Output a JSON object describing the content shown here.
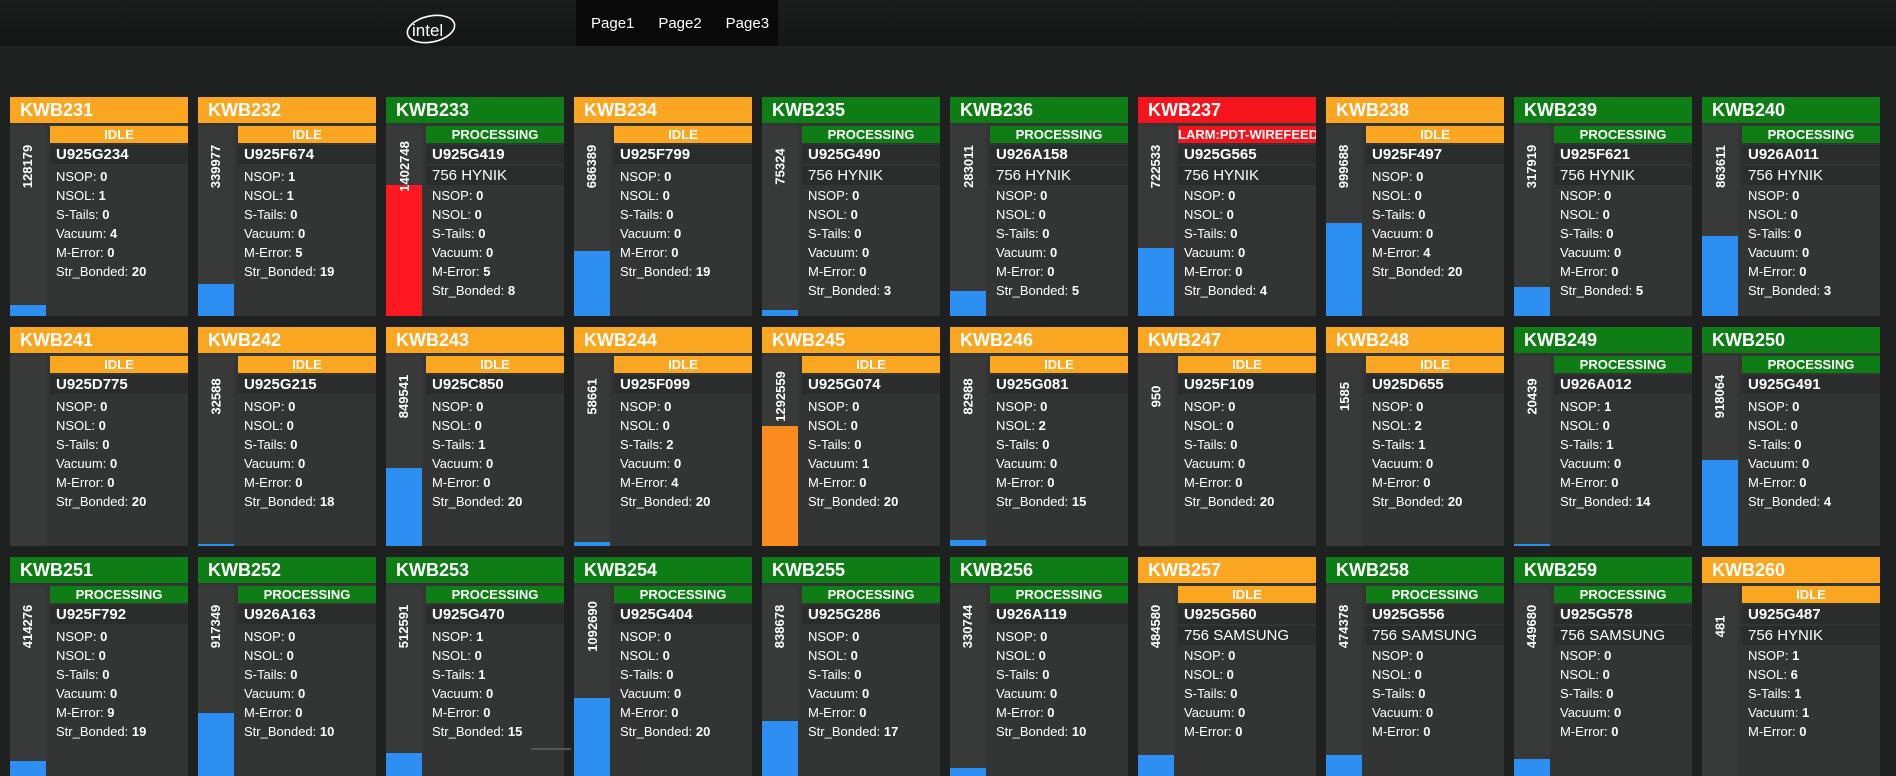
{
  "nav": [
    "Page1",
    "Page2",
    "Page3"
  ],
  "colors": {
    "idle": "#fba620",
    "processing": "#0e7d16",
    "alarm": "#f5141c",
    "bar_blue": "#2d8ff2",
    "bar_red": "#ff1721",
    "bar_orange": "#fb8b1e"
  },
  "icons": {
    "logo": "intel-logo"
  },
  "stat_labels": [
    "NSOP:",
    "NSOL:",
    "S-Tails:",
    "Vacuum:",
    "M-Error:",
    "Str_Bonded:"
  ],
  "machines": [
    {
      "name": "KWB231",
      "status": "IDLE",
      "state": "idle",
      "count": "128179",
      "level": 0.06,
      "bar": "blue",
      "unit": "U925G234",
      "sub": "",
      "stats": [
        "0",
        "1",
        "0",
        "4",
        "0",
        "20"
      ]
    },
    {
      "name": "KWB232",
      "status": "IDLE",
      "state": "idle",
      "count": "339977",
      "level": 0.17,
      "bar": "blue",
      "unit": "U925F674",
      "sub": "",
      "stats": [
        "1",
        "1",
        "0",
        "0",
        "5",
        "19"
      ]
    },
    {
      "name": "KWB233",
      "status": "PROCESSING",
      "state": "processing",
      "count": "1402748",
      "level": 0.69,
      "bar": "red",
      "unit": "U925G419",
      "sub": "756 HYNIK",
      "stats": [
        "0",
        "0",
        "0",
        "0",
        "5",
        "8"
      ]
    },
    {
      "name": "KWB234",
      "status": "IDLE",
      "state": "idle",
      "count": "686389",
      "level": 0.34,
      "bar": "blue",
      "unit": "U925F799",
      "sub": "",
      "stats": [
        "0",
        "0",
        "0",
        "0",
        "0",
        "19"
      ]
    },
    {
      "name": "KWB235",
      "status": "PROCESSING",
      "state": "processing",
      "count": "75324",
      "level": 0.03,
      "bar": "blue",
      "unit": "U925G490",
      "sub": "756 HYNIK",
      "stats": [
        "0",
        "0",
        "0",
        "0",
        "0",
        "3"
      ]
    },
    {
      "name": "KWB236",
      "status": "PROCESSING",
      "state": "processing",
      "count": "283011",
      "level": 0.13,
      "bar": "blue",
      "unit": "U926A158",
      "sub": "756 HYNIK",
      "stats": [
        "0",
        "0",
        "0",
        "0",
        "0",
        "5"
      ]
    },
    {
      "name": "KWB237",
      "status": "LARM:PDT-WIREFEED",
      "state": "alarm",
      "count": "722533",
      "level": 0.36,
      "bar": "blue",
      "unit": "U925G565",
      "sub": "756 HYNIK",
      "stats": [
        "0",
        "0",
        "0",
        "0",
        "0",
        "4"
      ]
    },
    {
      "name": "KWB238",
      "status": "IDLE",
      "state": "idle",
      "count": "999688",
      "level": 0.49,
      "bar": "blue",
      "unit": "U925F497",
      "sub": "",
      "stats": [
        "0",
        "0",
        "0",
        "0",
        "4",
        "20"
      ]
    },
    {
      "name": "KWB239",
      "status": "PROCESSING",
      "state": "processing",
      "count": "317919",
      "level": 0.15,
      "bar": "blue",
      "unit": "U925F621",
      "sub": "756 HYNIK",
      "stats": [
        "0",
        "0",
        "0",
        "0",
        "0",
        "5"
      ]
    },
    {
      "name": "KWB240",
      "status": "PROCESSING",
      "state": "processing",
      "count": "863611",
      "level": 0.42,
      "bar": "blue",
      "unit": "U926A011",
      "sub": "756 HYNIK",
      "stats": [
        "0",
        "0",
        "0",
        "0",
        "0",
        "3"
      ]
    },
    {
      "name": "KWB241",
      "status": "IDLE",
      "state": "idle",
      "count": "",
      "level": 0,
      "bar": "blue",
      "unit": "U925D775",
      "sub": "",
      "stats": [
        "0",
        "0",
        "0",
        "0",
        "0",
        "20"
      ]
    },
    {
      "name": "KWB242",
      "status": "IDLE",
      "state": "idle",
      "count": "32588",
      "level": 0.01,
      "bar": "blue",
      "unit": "U925G215",
      "sub": "",
      "stats": [
        "0",
        "0",
        "0",
        "0",
        "0",
        "18"
      ]
    },
    {
      "name": "KWB243",
      "status": "IDLE",
      "state": "idle",
      "count": "849541",
      "level": 0.41,
      "bar": "blue",
      "unit": "U925C850",
      "sub": "",
      "stats": [
        "0",
        "0",
        "1",
        "0",
        "0",
        "20"
      ]
    },
    {
      "name": "KWB244",
      "status": "IDLE",
      "state": "idle",
      "count": "58661",
      "level": 0.02,
      "bar": "blue",
      "unit": "U925F099",
      "sub": "",
      "stats": [
        "0",
        "0",
        "2",
        "0",
        "4",
        "20"
      ]
    },
    {
      "name": "KWB245",
      "status": "IDLE",
      "state": "idle",
      "count": "1292559",
      "level": 0.63,
      "bar": "orange",
      "unit": "U925G074",
      "sub": "",
      "stats": [
        "0",
        "0",
        "0",
        "1",
        "0",
        "20"
      ]
    },
    {
      "name": "KWB246",
      "status": "IDLE",
      "state": "idle",
      "count": "82988",
      "level": 0.03,
      "bar": "blue",
      "unit": "U925G081",
      "sub": "",
      "stats": [
        "0",
        "2",
        "0",
        "0",
        "0",
        "15"
      ]
    },
    {
      "name": "KWB247",
      "status": "IDLE",
      "state": "idle",
      "count": "950",
      "level": 0,
      "bar": "blue",
      "unit": "U925F109",
      "sub": "",
      "stats": [
        "0",
        "0",
        "0",
        "0",
        "0",
        "20"
      ]
    },
    {
      "name": "KWB248",
      "status": "IDLE",
      "state": "idle",
      "count": "1585",
      "level": 0,
      "bar": "blue",
      "unit": "U925D655",
      "sub": "",
      "stats": [
        "0",
        "2",
        "1",
        "0",
        "0",
        "20"
      ]
    },
    {
      "name": "KWB249",
      "status": "PROCESSING",
      "state": "processing",
      "count": "20439",
      "level": 0.01,
      "bar": "blue",
      "unit": "U926A012",
      "sub": "",
      "stats": [
        "1",
        "0",
        "1",
        "0",
        "0",
        "14"
      ]
    },
    {
      "name": "KWB250",
      "status": "PROCESSING",
      "state": "processing",
      "count": "918064",
      "level": 0.45,
      "bar": "blue",
      "unit": "U925G491",
      "sub": "",
      "stats": [
        "0",
        "0",
        "0",
        "0",
        "0",
        "4"
      ]
    },
    {
      "name": "KWB251",
      "status": "PROCESSING",
      "state": "processing",
      "count": "414276",
      "level": 0.08,
      "bar": "blue",
      "unit": "U925F792",
      "sub": "",
      "stats": [
        "0",
        "0",
        "0",
        "0",
        "9",
        "19"
      ]
    },
    {
      "name": "KWB252",
      "status": "PROCESSING",
      "state": "processing",
      "count": "917349",
      "level": 0.33,
      "bar": "blue",
      "unit": "U926A163",
      "sub": "",
      "stats": [
        "0",
        "0",
        "0",
        "0",
        "0",
        "10"
      ]
    },
    {
      "name": "KWB253",
      "status": "PROCESSING",
      "state": "processing",
      "count": "512591",
      "level": 0.12,
      "bar": "blue",
      "unit": "U925G470",
      "sub": "",
      "stats": [
        "1",
        "0",
        "1",
        "0",
        "0",
        "15"
      ]
    },
    {
      "name": "KWB254",
      "status": "PROCESSING",
      "state": "processing",
      "count": "1092690",
      "level": 0.41,
      "bar": "blue",
      "unit": "U925G404",
      "sub": "",
      "stats": [
        "0",
        "0",
        "0",
        "0",
        "0",
        "20"
      ]
    },
    {
      "name": "KWB255",
      "status": "PROCESSING",
      "state": "processing",
      "count": "838678",
      "level": 0.29,
      "bar": "blue",
      "unit": "U925G286",
      "sub": "",
      "stats": [
        "0",
        "0",
        "0",
        "0",
        "0",
        "17"
      ]
    },
    {
      "name": "KWB256",
      "status": "PROCESSING",
      "state": "processing",
      "count": "330744",
      "level": 0.04,
      "bar": "blue",
      "unit": "U926A119",
      "sub": "",
      "stats": [
        "0",
        "0",
        "0",
        "0",
        "0",
        "10"
      ]
    },
    {
      "name": "KWB257",
      "status": "IDLE",
      "state": "idle",
      "count": "484580",
      "level": 0.11,
      "bar": "blue",
      "unit": "U925G560",
      "sub": "756 SAMSUNG",
      "stats": [
        "0",
        "0",
        "0",
        "0",
        "0"
      ]
    },
    {
      "name": "KWB258",
      "status": "PROCESSING",
      "state": "processing",
      "count": "474378",
      "level": 0.11,
      "bar": "blue",
      "unit": "U925G556",
      "sub": "756 SAMSUNG",
      "stats": [
        "0",
        "0",
        "0",
        "0",
        "0"
      ]
    },
    {
      "name": "KWB259",
      "status": "PROCESSING",
      "state": "processing",
      "count": "449680",
      "level": 0.09,
      "bar": "blue",
      "unit": "U925G578",
      "sub": "756 SAMSUNG",
      "stats": [
        "0",
        "0",
        "0",
        "0",
        "0"
      ]
    },
    {
      "name": "KWB260",
      "status": "IDLE",
      "state": "idle",
      "count": "481",
      "level": 0,
      "bar": "blue",
      "unit": "U925G487",
      "sub": "756 HYNIK",
      "stats": [
        "1",
        "6",
        "1",
        "1",
        "0"
      ]
    }
  ]
}
